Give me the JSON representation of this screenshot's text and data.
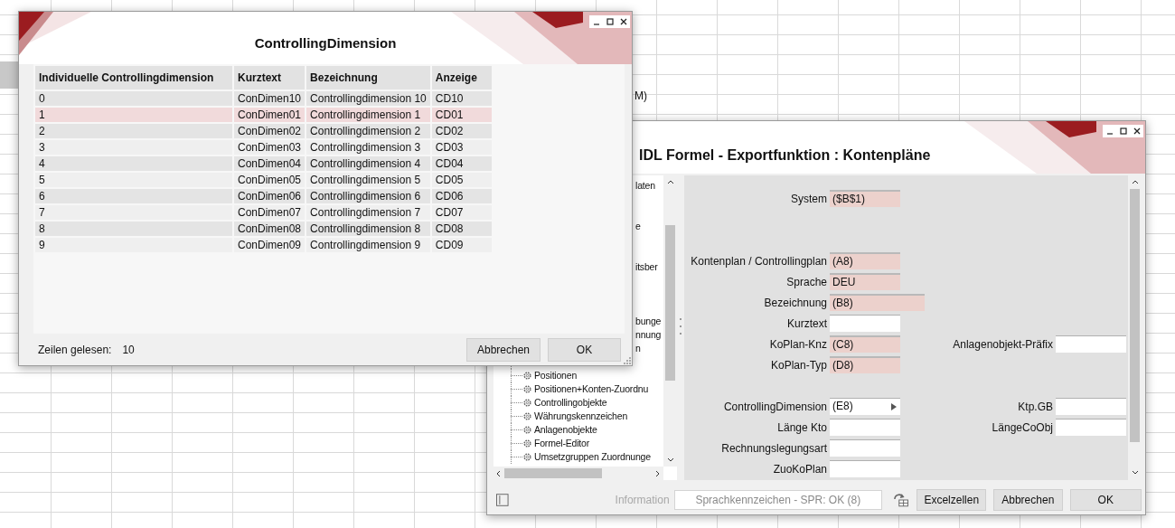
{
  "sheet": {
    "fragment": "M)"
  },
  "dialog": {
    "title": "ControllingDimension",
    "columns": [
      "Individuelle Controllingdimension",
      "Kurztext",
      "Bezeichnung",
      "Anzeige"
    ],
    "rows": [
      {
        "cells": [
          "0",
          "ConDimen10",
          "Controllingdimension 10",
          "CD10"
        ],
        "selected": false
      },
      {
        "cells": [
          "1",
          "ConDimen01",
          "Controllingdimension 1",
          "CD01"
        ],
        "selected": true
      },
      {
        "cells": [
          "2",
          "ConDimen02",
          "Controllingdimension 2",
          "CD02"
        ],
        "selected": false
      },
      {
        "cells": [
          "3",
          "ConDimen03",
          "Controllingdimension 3",
          "CD03"
        ],
        "selected": false
      },
      {
        "cells": [
          "4",
          "ConDimen04",
          "Controllingdimension 4",
          "CD04"
        ],
        "selected": false
      },
      {
        "cells": [
          "5",
          "ConDimen05",
          "Controllingdimension 5",
          "CD05"
        ],
        "selected": false
      },
      {
        "cells": [
          "6",
          "ConDimen06",
          "Controllingdimension 6",
          "CD06"
        ],
        "selected": false
      },
      {
        "cells": [
          "7",
          "ConDimen07",
          "Controllingdimension 7",
          "CD07"
        ],
        "selected": false
      },
      {
        "cells": [
          "8",
          "ConDimen08",
          "Controllingdimension 8",
          "CD08"
        ],
        "selected": false
      },
      {
        "cells": [
          "9",
          "ConDimen09",
          "Controllingdimension 9",
          "CD09"
        ],
        "selected": false
      }
    ],
    "status_label": "Zeilen gelesen:",
    "status_value": "10",
    "buttons": [
      "Abbrechen",
      "OK"
    ]
  },
  "export_window": {
    "title": "IDL Formel - Exportfunktion : Kontenpläne",
    "tree": [
      {
        "kind": "fragment",
        "label": "laten"
      },
      {
        "kind": "covered"
      },
      {
        "kind": "covered"
      },
      {
        "kind": "fragment",
        "label": "e"
      },
      {
        "kind": "covered"
      },
      {
        "kind": "covered"
      },
      {
        "kind": "fragment",
        "label": "itsber"
      },
      {
        "kind": "covered"
      },
      {
        "kind": "covered"
      },
      {
        "kind": "covered"
      },
      {
        "kind": "fragment",
        "label": "bunge"
      },
      {
        "kind": "fragment",
        "label": "nnung"
      },
      {
        "kind": "fragment",
        "label": "n"
      },
      {
        "kind": "covered"
      },
      {
        "kind": "item",
        "label": "Positionen"
      },
      {
        "kind": "item",
        "label": "Positionen+Konten-Zuordnu"
      },
      {
        "kind": "item",
        "label": "Controllingobjekte"
      },
      {
        "kind": "item",
        "label": "Währungskennzeichen"
      },
      {
        "kind": "item",
        "label": "Anlagenobjekte"
      },
      {
        "kind": "item",
        "label": "Formel-Editor"
      },
      {
        "kind": "item",
        "label": "Umsetzgruppen Zuordnunge"
      }
    ],
    "form_rows": [
      {
        "kind": "field",
        "label": "System",
        "field": {
          "kind": "cell",
          "value": "($B$1)"
        }
      },
      {
        "kind": "blank"
      },
      {
        "kind": "blank"
      },
      {
        "kind": "field",
        "label": "Kontenplan / Controllingplan",
        "field": {
          "kind": "cell",
          "value": "(A8)"
        }
      },
      {
        "kind": "field",
        "label": "Sprache",
        "field": {
          "kind": "cell",
          "value": "DEU"
        }
      },
      {
        "kind": "field",
        "label": "Bezeichnung",
        "field": {
          "kind": "cell",
          "value": "(B8)",
          "wide": true
        }
      },
      {
        "kind": "field",
        "label": "Kurztext",
        "field": {
          "kind": "input"
        }
      },
      {
        "kind": "field",
        "label": "KoPlan-Knz",
        "field": {
          "kind": "cell",
          "value": "(C8)"
        },
        "right": {
          "label": "Anlagenobjekt-Präfix",
          "field": {
            "kind": "input"
          }
        }
      },
      {
        "kind": "field",
        "label": "KoPlan-Typ",
        "field": {
          "kind": "cell",
          "value": "(D8)"
        }
      },
      {
        "kind": "blank"
      },
      {
        "kind": "field",
        "label": "ControllingDimension",
        "field": {
          "kind": "picker",
          "value": "(E8)"
        },
        "right": {
          "label": "Ktp.GB",
          "field": {
            "kind": "input"
          }
        }
      },
      {
        "kind": "field",
        "label": "Länge Kto",
        "field": {
          "kind": "input"
        },
        "right": {
          "label": "LängeCoObj",
          "field": {
            "kind": "input"
          }
        }
      },
      {
        "kind": "field",
        "label": "Rechnungslegungsart",
        "field": {
          "kind": "input"
        }
      },
      {
        "kind": "field",
        "label": "ZuoKoPlan",
        "field": {
          "kind": "input"
        }
      }
    ],
    "info_label": "Information",
    "info_value": "Sprachkennzeichen - SPR: OK (8)",
    "buttons": [
      "Excelzellen",
      "Abbrechen",
      "OK"
    ]
  }
}
